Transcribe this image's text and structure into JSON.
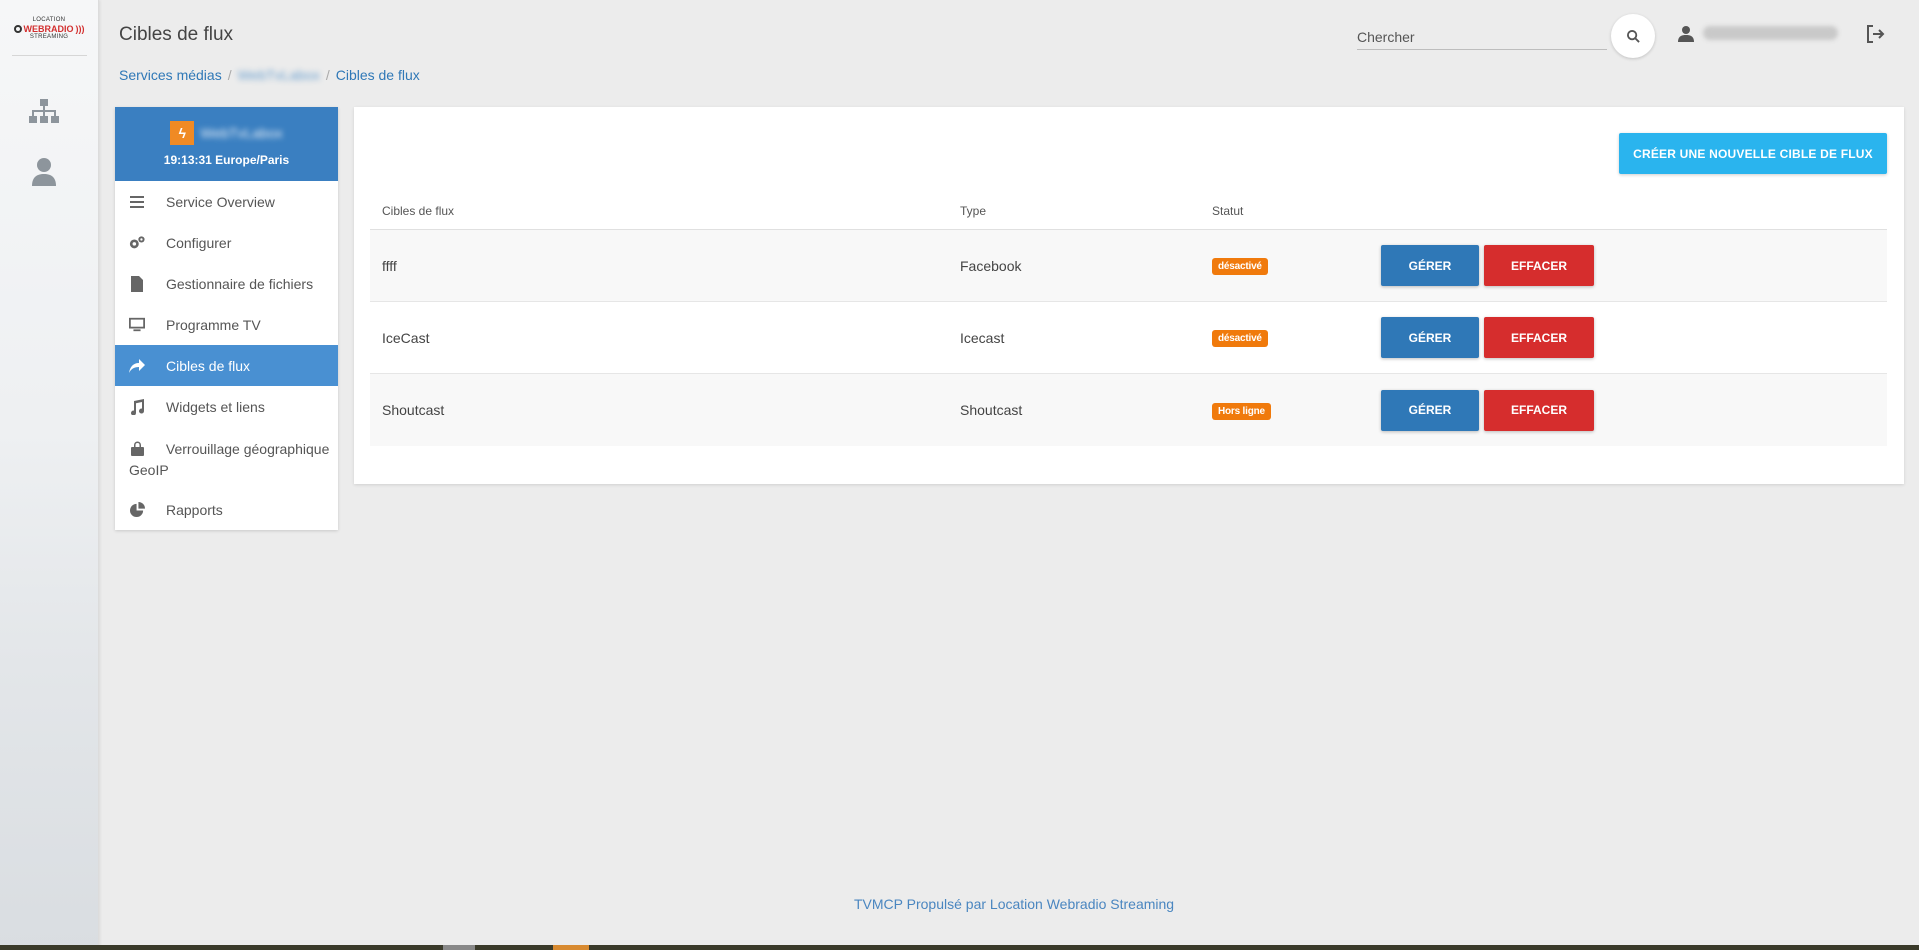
{
  "header": {
    "title": "Cibles de flux",
    "search_placeholder": "Chercher"
  },
  "breadcrumb": {
    "items": [
      "Services médias",
      "WebTvLabox",
      "Cibles de flux"
    ]
  },
  "station": {
    "name": "WebTvLabox",
    "time": "19:13:31 Europe/Paris"
  },
  "sidebar": {
    "items": [
      {
        "label": "Service Overview",
        "icon": "list-icon"
      },
      {
        "label": "Configurer",
        "icon": "gears-icon"
      },
      {
        "label": "Gestionnaire de fichiers",
        "icon": "file-icon"
      },
      {
        "label": "Programme TV",
        "icon": "monitor-icon"
      },
      {
        "label": "Cibles de flux",
        "icon": "share-icon",
        "active": true
      },
      {
        "label": "Widgets et liens",
        "icon": "music-icon"
      },
      {
        "label": "Verrouillage géographique GeoIP",
        "icon": "lock-icon"
      },
      {
        "label": "Rapports",
        "icon": "pie-chart-icon"
      }
    ]
  },
  "main": {
    "create_button": "Créer une nouvelle cible de flux",
    "columns": [
      "Cibles de flux",
      "Type",
      "Statut"
    ],
    "rows": [
      {
        "name": "ffff",
        "type": "Facebook",
        "status": "désactivé",
        "manage": "Gérer",
        "delete": "Effacer"
      },
      {
        "name": "IceCast",
        "type": "Icecast",
        "status": "désactivé",
        "manage": "Gérer",
        "delete": "Effacer"
      },
      {
        "name": "Shoutcast",
        "type": "Shoutcast",
        "status": "Hors ligne",
        "manage": "Gérer",
        "delete": "Effacer"
      }
    ]
  },
  "footer": {
    "text": "TVMCP Propulsé par Location Webradio Streaming"
  },
  "logo": {
    "top": "LOCATION",
    "main": "WEBRADIO",
    "bottom": "STREAMING"
  },
  "colors": {
    "primary": "#2f78b7",
    "danger": "#d62d2d",
    "info": "#2ab4ee",
    "warning": "#f07a0c",
    "active_nav": "#4990d2"
  }
}
